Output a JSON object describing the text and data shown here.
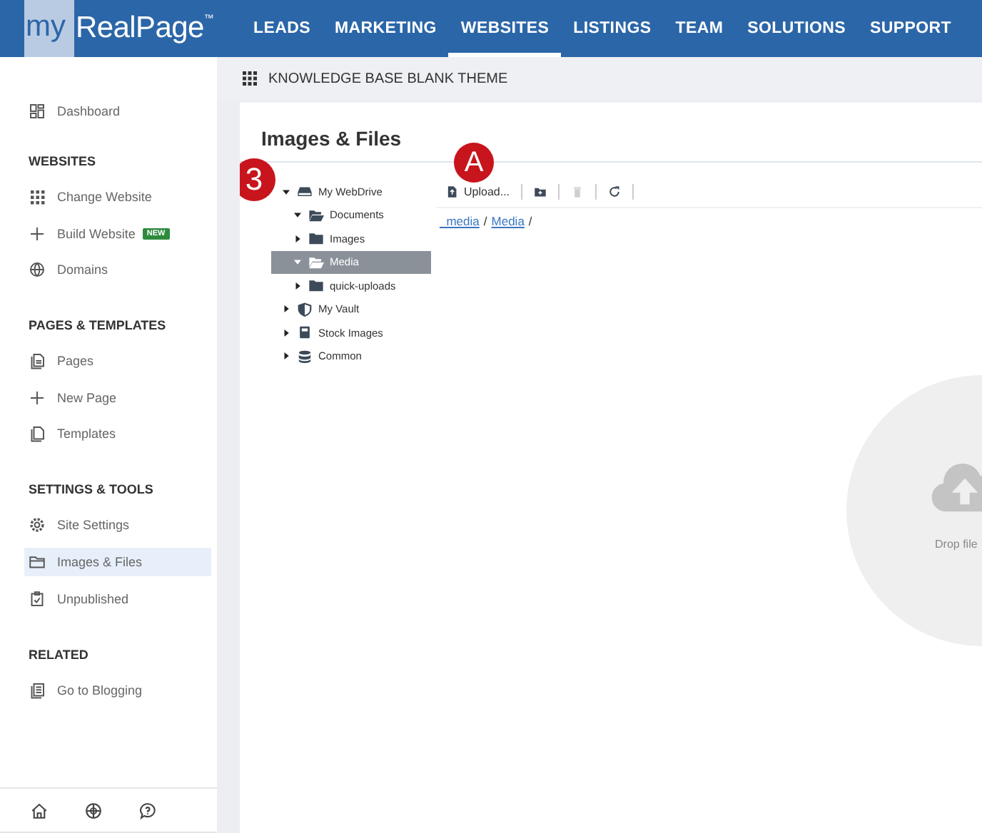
{
  "header": {
    "logo": {
      "prefix": "my",
      "name": "RealPage",
      "mark": "™"
    },
    "nav": [
      {
        "label": "LEADS",
        "selected": false
      },
      {
        "label": "MARKETING",
        "selected": false
      },
      {
        "label": "WEBSITES",
        "selected": true
      },
      {
        "label": "LISTINGS",
        "selected": false
      },
      {
        "label": "TEAM",
        "selected": false
      },
      {
        "label": "SOLUTIONS",
        "selected": false
      },
      {
        "label": "SUPPORT",
        "selected": false
      }
    ]
  },
  "sidebar": {
    "sections": [
      {
        "items": [
          {
            "label": "Dashboard",
            "selected": false
          }
        ]
      },
      {
        "title": "WEBSITES",
        "items": [
          {
            "label": "Change Website",
            "selected": false
          },
          {
            "label": "Build Website",
            "badge": "NEW",
            "selected": false
          },
          {
            "label": "Domains",
            "selected": false
          }
        ]
      },
      {
        "title": "PAGES & TEMPLATES",
        "items": [
          {
            "label": "Pages",
            "selected": false
          },
          {
            "label": "New Page",
            "selected": false
          },
          {
            "label": "Templates",
            "selected": false
          }
        ]
      },
      {
        "title": "SETTINGS & TOOLS",
        "items": [
          {
            "label": "Site Settings",
            "selected": false
          },
          {
            "label": "Images & Files",
            "selected": true
          },
          {
            "label": "Unpublished",
            "selected": false
          }
        ]
      },
      {
        "title": "RELATED",
        "items": [
          {
            "label": "Go to Blogging",
            "selected": false
          }
        ]
      }
    ]
  },
  "theme_bar": {
    "title": "KNOWLEDGE BASE BLANK THEME"
  },
  "panel": {
    "title": "Images & Files",
    "tree": [
      {
        "label": "My WebDrive",
        "expanded": true,
        "selected": false,
        "children": [
          {
            "label": "Documents",
            "expanded": true,
            "selected": false
          },
          {
            "label": "Images",
            "expanded": false,
            "selected": false
          },
          {
            "label": "Media",
            "expanded": true,
            "selected": true
          },
          {
            "label": "quick-uploads",
            "expanded": false,
            "selected": false
          }
        ]
      },
      {
        "label": "My Vault",
        "expanded": false,
        "selected": false
      },
      {
        "label": "Stock Images",
        "expanded": false,
        "selected": false
      },
      {
        "label": "Common",
        "expanded": false,
        "selected": false
      }
    ],
    "toolbar": [
      {
        "kind": "upload",
        "label": "Upload...",
        "disabled": false
      },
      {
        "kind": "new-folder",
        "disabled": false
      },
      {
        "kind": "delete",
        "disabled": true
      },
      {
        "kind": "refresh",
        "disabled": false
      }
    ],
    "breadcrumb": [
      {
        "label": "_media",
        "separator": "/"
      },
      {
        "label": "Media",
        "separator": "/"
      }
    ],
    "drop_zone": {
      "text": "Drop file"
    }
  },
  "annotations": [
    {
      "label": "3"
    },
    {
      "label": "A"
    }
  ]
}
